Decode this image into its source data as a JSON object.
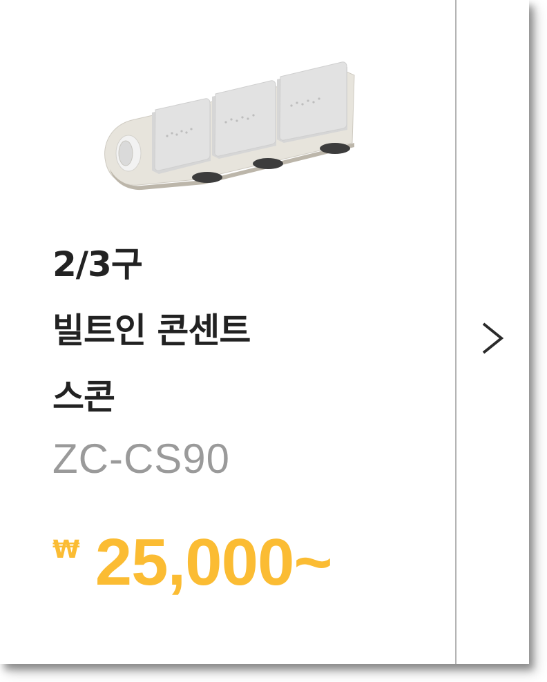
{
  "product": {
    "title_lines": [
      "2/3구",
      "빌트인 콘센트",
      "스콘"
    ],
    "model": "ZC-CS90",
    "price": {
      "currency_symbol": "₩",
      "amount": "25,000~"
    },
    "image_icon": "power-strip-icon"
  },
  "navigation": {
    "next_icon": "chevron-right-icon"
  },
  "colors": {
    "price": "#fbbc33",
    "title": "#222222",
    "model": "#9a9a9a",
    "divider": "#b4b4b4"
  }
}
